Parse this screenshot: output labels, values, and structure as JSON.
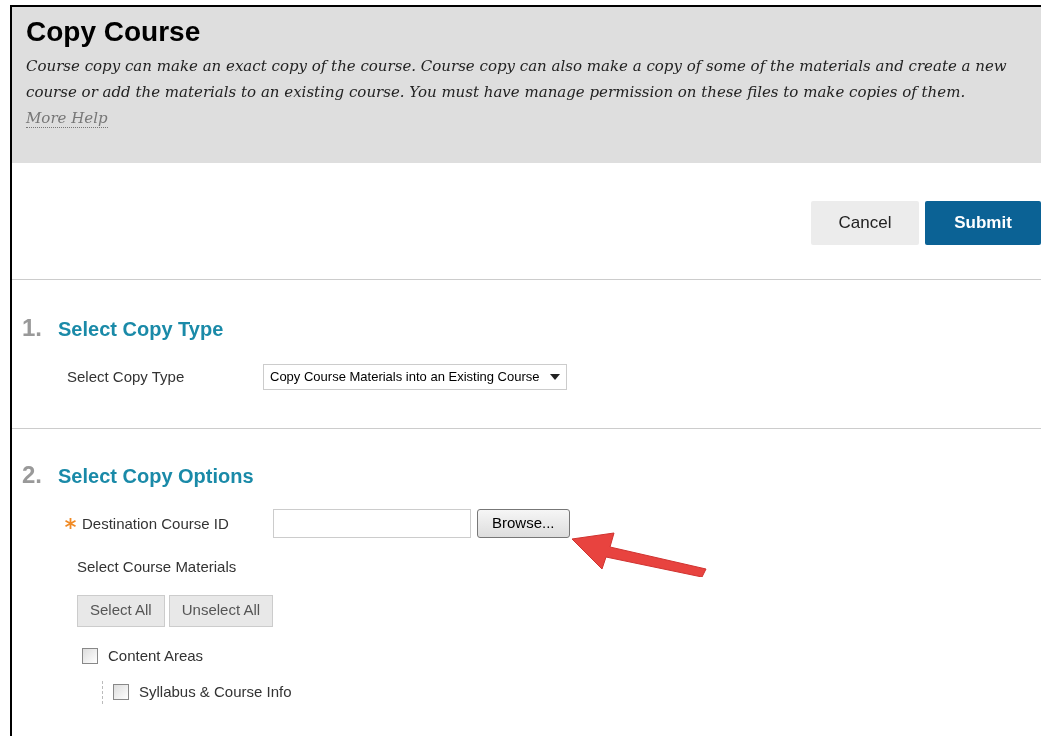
{
  "header": {
    "title": "Copy Course",
    "description": "Course copy can make an exact copy of the course. Course copy can also make a copy of some of the materials and create a new course or add the materials to an existing course. You must have manage permission on these files to make copies of them.",
    "help_link": "More Help"
  },
  "actions": [
    {
      "label": "Cancel",
      "kind": "secondary"
    },
    {
      "label": "Submit",
      "kind": "primary"
    }
  ],
  "step1": {
    "number": "1.",
    "title": "Select Copy Type",
    "field_label": "Select Copy Type",
    "select_value": "Copy Course Materials into an Existing Course"
  },
  "step2": {
    "number": "2.",
    "title": "Select Copy Options",
    "destination": {
      "label": "Destination Course ID",
      "required": true,
      "browse": "Browse..."
    },
    "materials_label": "Select Course Materials",
    "bulk_buttons": [
      "Select All",
      "Unselect All"
    ],
    "materials": [
      {
        "label": "Content Areas",
        "checked": false,
        "children": [
          {
            "label": "Syllabus & Course Info",
            "checked": false
          }
        ]
      }
    ]
  }
}
